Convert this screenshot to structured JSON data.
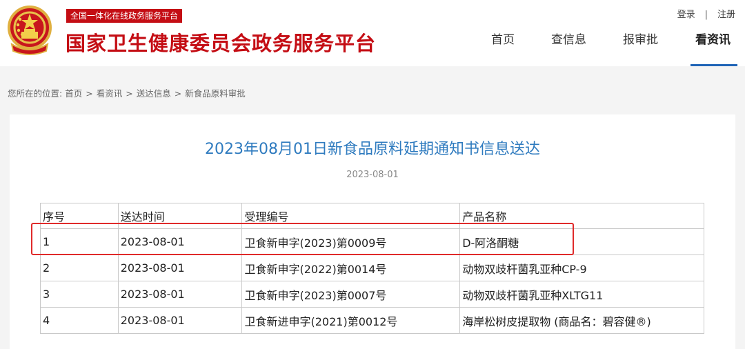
{
  "header": {
    "platform_tag": "全国一体化在线政务服务平台",
    "site_title": "国家卫生健康委员会政务服务平台",
    "login_label": "登录",
    "separator": "|",
    "register_label": "注册",
    "brand_color": "#c40d14"
  },
  "nav": {
    "items": [
      {
        "label": "首页"
      },
      {
        "label": "查信息"
      },
      {
        "label": "报审批"
      },
      {
        "label": "看资讯",
        "active": true
      }
    ],
    "active_color": "#1f64b7"
  },
  "breadcrumb": {
    "prefix": "您所在的位置:",
    "items": [
      "首页",
      "看资讯",
      "送达信息",
      "新食品原料审批"
    ],
    "arrow": ">"
  },
  "document": {
    "title": "2023年08月01日新食品原料延期通知书信息送达",
    "date": "2023-08-01",
    "title_color": "#2f7bbf"
  },
  "table": {
    "headers": [
      "序号",
      "送达时间",
      "受理编号",
      "产品名称"
    ],
    "rows": [
      [
        "1",
        "2023-08-01",
        "卫食新申字(2023)第0009号",
        "D-阿洛酮糖"
      ],
      [
        "2",
        "2023-08-01",
        "卫食新申字(2022)第0014号",
        "动物双歧杆菌乳亚种CP-9"
      ],
      [
        "3",
        "2023-08-01",
        "卫食新申字(2023)第0007号",
        "动物双歧杆菌乳亚种XLTG11"
      ],
      [
        "4",
        "2023-08-01",
        "卫食新进申字(2021)第0012号",
        "海岸松树皮提取物 (商品名：碧容健®)"
      ]
    ],
    "highlight_color": "#e02a2a"
  }
}
